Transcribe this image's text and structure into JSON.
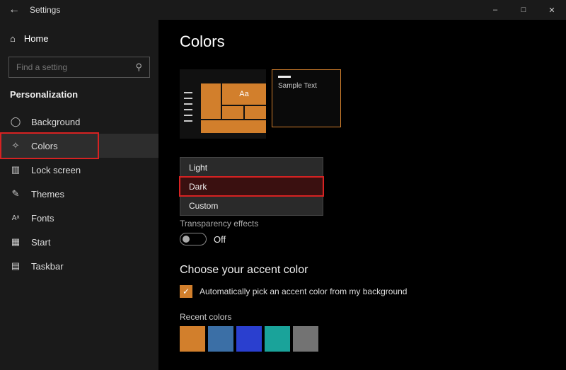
{
  "window": {
    "title": "Settings"
  },
  "sidebar": {
    "home": "Home",
    "search_placeholder": "Find a setting",
    "category": "Personalization",
    "items": [
      {
        "icon": "image-icon",
        "label": "Background"
      },
      {
        "icon": "palette-icon",
        "label": "Colors"
      },
      {
        "icon": "monitor-icon",
        "label": "Lock screen"
      },
      {
        "icon": "brush-icon",
        "label": "Themes"
      },
      {
        "icon": "font-icon",
        "label": "Fonts"
      },
      {
        "icon": "start-icon",
        "label": "Start"
      },
      {
        "icon": "taskbar-icon",
        "label": "Taskbar"
      }
    ]
  },
  "page": {
    "heading": "Colors",
    "preview_tile_text": "Aa",
    "preview_sample": "Sample Text",
    "color_mode_options": [
      "Light",
      "Dark",
      "Custom"
    ],
    "color_mode_selected": "Dark",
    "transparency_label": "Transparency effects",
    "toggle_state": "Off",
    "accent_heading": "Choose your accent color",
    "auto_pick_label": "Automatically pick an accent color from my background",
    "recent_label": "Recent colors",
    "recent_colors": [
      "#d27f2c",
      "#3b6fa6",
      "#2a3fcf",
      "#1aa39a",
      "#737373"
    ],
    "accent_color": "#d27f2c",
    "highlight_color": "#d62222"
  }
}
